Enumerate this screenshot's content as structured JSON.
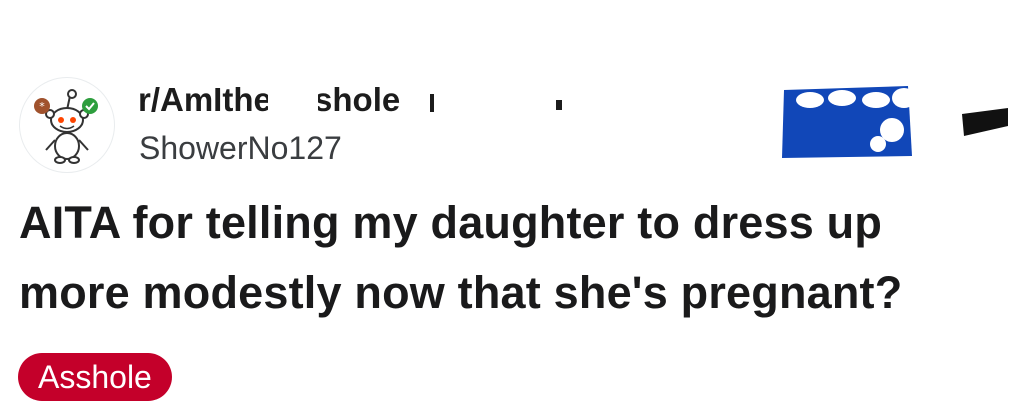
{
  "post": {
    "subreddit": "r/AmItheAsshole",
    "username": "ShowerNo127",
    "title": "AITA for telling my daughter to dress up more modestly now that she's pregnant?",
    "flair": "Asshole"
  },
  "icons": {
    "avatar": "reddit-snoo-avatar-icon",
    "redaction_blue": "blue-scribble-redaction",
    "redaction_black": "black-scribble-redaction"
  },
  "colors": {
    "flair_background": "#c4002a",
    "redaction_blue": "#1147b8",
    "text": "#1a1a1b"
  }
}
